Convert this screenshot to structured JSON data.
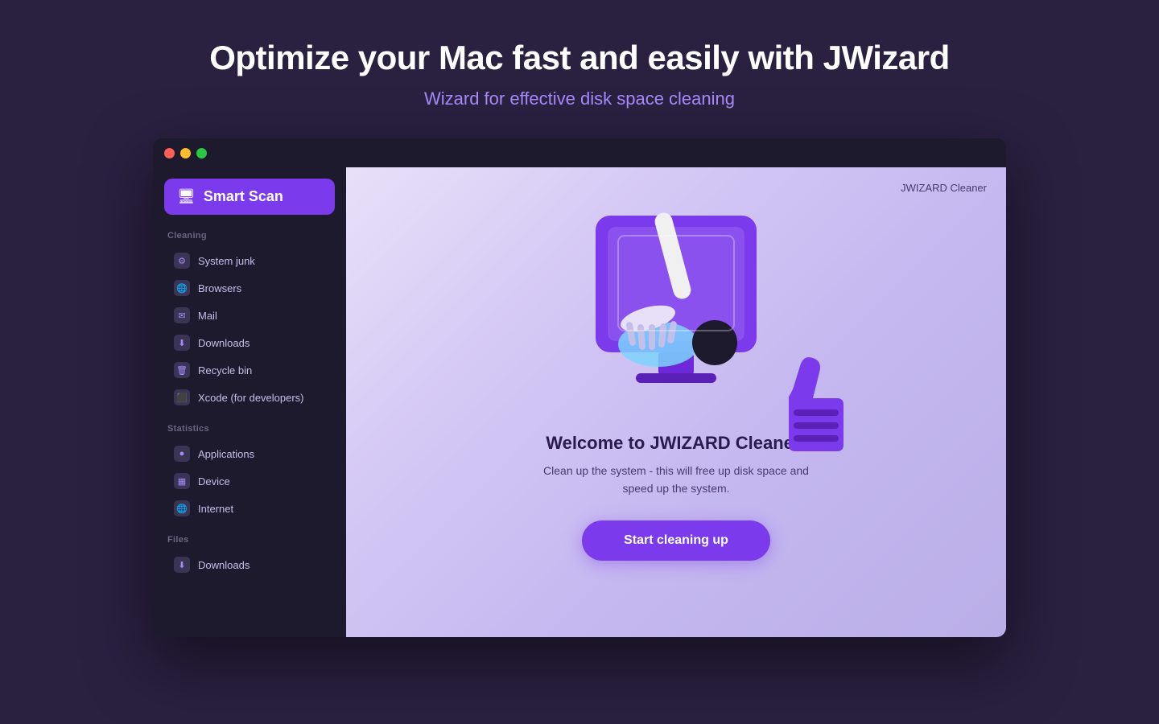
{
  "page": {
    "main_title": "Optimize your Mac fast and easily with JWizard",
    "sub_title": "Wizard for effective disk space cleaning"
  },
  "titlebar": {
    "traffic_lights": [
      "red",
      "yellow",
      "green"
    ]
  },
  "sidebar": {
    "smart_scan_label": "Smart Scan",
    "sections": [
      {
        "title": "Cleaning",
        "items": [
          {
            "label": "System junk",
            "icon": "⚙"
          },
          {
            "label": "Browsers",
            "icon": "🌐"
          },
          {
            "label": "Mail",
            "icon": "✉"
          },
          {
            "label": "Downloads",
            "icon": "⬇"
          },
          {
            "label": "Recycle bin",
            "icon": "🗑"
          },
          {
            "label": "Xcode (for developers)",
            "icon": "⬛"
          }
        ]
      },
      {
        "title": "Statistics",
        "items": [
          {
            "label": "Applications",
            "icon": "●"
          },
          {
            "label": "Device",
            "icon": "▦"
          },
          {
            "label": "Internet",
            "icon": "🌐"
          }
        ]
      },
      {
        "title": "Files",
        "items": [
          {
            "label": "Downloads",
            "icon": "⬇"
          }
        ]
      }
    ]
  },
  "main": {
    "app_name": "JWIZARD Cleaner",
    "welcome_title": "Welcome to JWIZARD Cleaner!",
    "welcome_desc": "Clean up the system - this will free up disk space and\nspeed up the system.",
    "start_button_label": "Start cleaning up"
  }
}
